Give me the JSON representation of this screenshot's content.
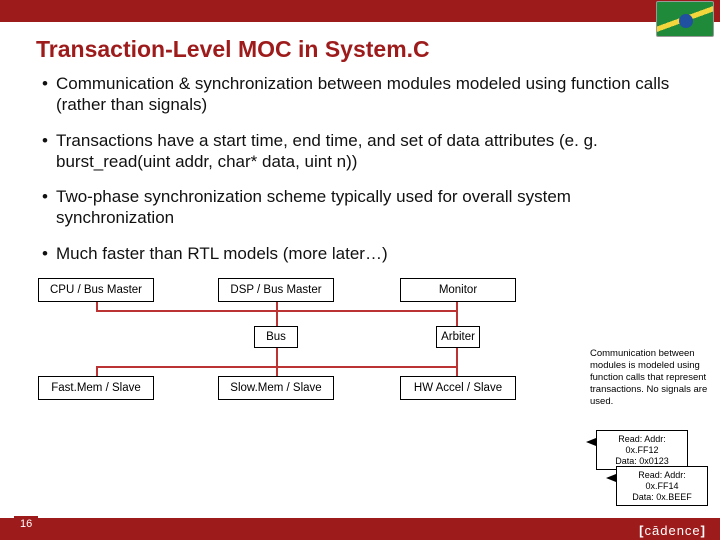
{
  "title": "Transaction-Level MOC in System.C",
  "bullets": [
    "Communication & synchronization between modules modeled using function calls (rather than signals)",
    "Transactions have a start time, end time, and set of data attributes (e. g. burst_read(uint addr, char* data, uint n))",
    "Two-phase synchronization scheme typically used for overall system synchronization",
    "Much faster than RTL models (more later…)"
  ],
  "diagram": {
    "cpu": "CPU / Bus Master",
    "dsp": "DSP / Bus Master",
    "monitor": "Monitor",
    "bus": "Bus",
    "arbiter": "Arbiter",
    "fastmem": "Fast.Mem / Slave",
    "slowmem": "Slow.Mem / Slave",
    "hwaccel": "HW Accel / Slave"
  },
  "sidenote": "Communication between modules is modeled using function calls that represent transactions. No signals are used.",
  "callouts": {
    "c1_line1": "Read:  Addr: 0x.FF12",
    "c1_line2": "Data: 0x0123",
    "c2_line1": "Read:  Addr: 0x.FF14",
    "c2_line2": "Data: 0x.BEEF"
  },
  "slide_number": "16",
  "logo_text": "cādence"
}
